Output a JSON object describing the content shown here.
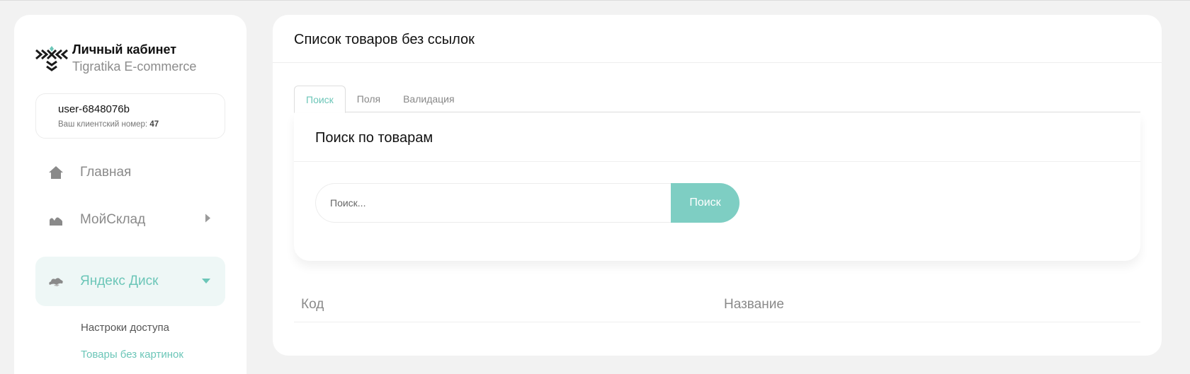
{
  "brand": {
    "title": "Личный кабинет",
    "subtitle": "Tigratika E-commerce"
  },
  "user": {
    "name": "user-6848076b",
    "client_label": "Ваш клиентский номер:",
    "client_number": "47"
  },
  "nav": {
    "items": [
      {
        "label": "Главная",
        "icon": "home-icon"
      },
      {
        "label": "МойСклад",
        "icon": "warehouse-icon"
      },
      {
        "label": "Яндекс Диск",
        "icon": "cloud-icon",
        "active": true
      }
    ],
    "sub_items": [
      {
        "label": "Настроки доступа"
      },
      {
        "label": "Товары без картинок",
        "active": true
      }
    ]
  },
  "main": {
    "title": "Список товаров без ссылок",
    "tabs": [
      {
        "label": "Поиск",
        "active": true
      },
      {
        "label": "Поля"
      },
      {
        "label": "Валидация"
      }
    ],
    "search_card": {
      "title": "Поиск по товарам",
      "placeholder": "Поиск...",
      "button_label": "Поиск"
    },
    "table": {
      "columns": [
        "Код",
        "Название"
      ]
    }
  },
  "colors": {
    "accent": "#6cc6b8",
    "button": "#7ecec3",
    "active_bg": "#eef7f6"
  }
}
